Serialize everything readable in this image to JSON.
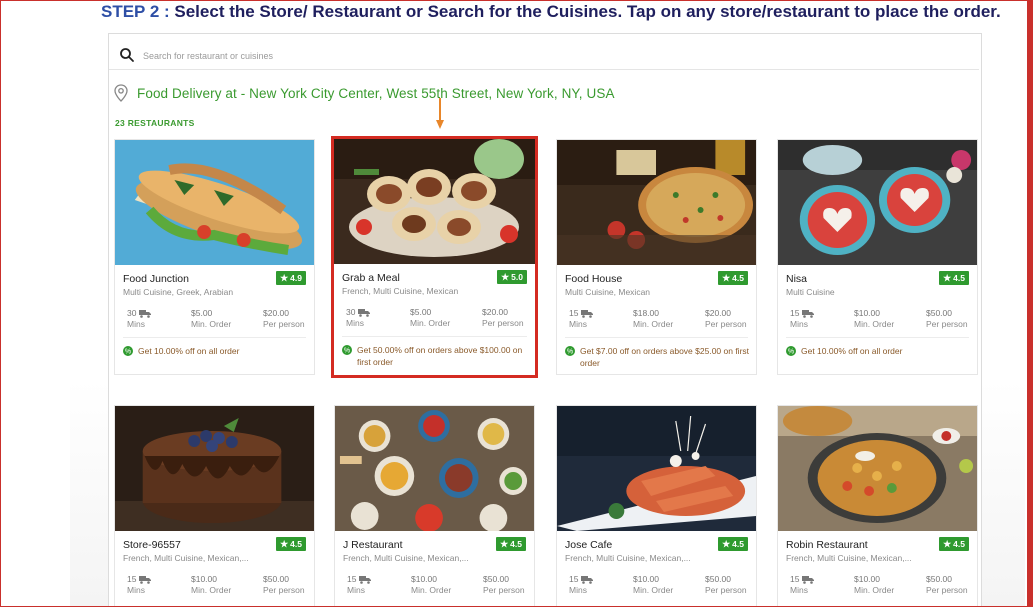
{
  "instruction": {
    "step_label": "STEP 2 :",
    "text": "Select the Store/ Restaurant or Search for the Cuisines. Tap on any store/restaurant to place the order."
  },
  "search": {
    "placeholder": "Search for restaurant or cuisines"
  },
  "location": {
    "text": "Food Delivery at - New York City Center, West 55th Street, New York, NY, USA"
  },
  "restaurant_count": "23 RESTAURANTS",
  "colors": {
    "accent_green": "#3a9a2f",
    "rating_green": "#2f9a2f",
    "highlight_red": "#d42b22",
    "arrow_orange": "#e8862a"
  },
  "restaurants": [
    {
      "name": "Food Junction",
      "cuisine": "Multi Cuisine, Greek, Arabian",
      "rating": "4.9",
      "time": "30",
      "time_label": "Mins",
      "min_order": "$5.00",
      "min_order_label": "Min. Order",
      "per_person": "$20.00",
      "per_person_label": "Per person",
      "offer": "Get 10.00% off on all order",
      "photo": "sandwich-image"
    },
    {
      "name": "Grab a Meal",
      "cuisine": "French, Multi Cuisine, Mexican",
      "rating": "5.0",
      "time": "30",
      "time_label": "Mins",
      "min_order": "$5.00",
      "min_order_label": "Min. Order",
      "per_person": "$20.00",
      "per_person_label": "Per person",
      "offer": "Get 50.00% off on orders above $100.00 on first order",
      "photo": "wraps-image",
      "selected": true
    },
    {
      "name": "Food House",
      "cuisine": "Multi Cuisine, Mexican",
      "rating": "4.5",
      "time": "15",
      "time_label": "Mins",
      "min_order": "$18.00",
      "min_order_label": "Min. Order",
      "per_person": "$20.00",
      "per_person_label": "Per person",
      "offer": "Get $7.00 off on orders above $25.00 on first order",
      "photo": "pizza-image"
    },
    {
      "name": "Nisa",
      "cuisine": "Multi Cuisine",
      "rating": "4.5",
      "time": "15",
      "time_label": "Mins",
      "min_order": "$10.00",
      "min_order_label": "Min. Order",
      "per_person": "$50.00",
      "per_person_label": "Per person",
      "offer": "Get 10.00% off on all order",
      "photo": "heart-pancakes-image"
    },
    {
      "name": "Store-96557",
      "cuisine": "French, Multi Cuisine, Mexican,...",
      "rating": "4.5",
      "time": "15",
      "time_label": "Mins",
      "min_order": "$10.00",
      "min_order_label": "Min. Order",
      "per_person": "$50.00",
      "per_person_label": "Per person",
      "photo": "chocolate-cake-image"
    },
    {
      "name": "J Restaurant",
      "cuisine": "French, Multi Cuisine, Mexican,...",
      "rating": "4.5",
      "time": "15",
      "time_label": "Mins",
      "min_order": "$10.00",
      "min_order_label": "Min. Order",
      "per_person": "$50.00",
      "per_person_label": "Per person",
      "photo": "table-spread-image"
    },
    {
      "name": "Jose Cafe",
      "cuisine": "French, Multi Cuisine, Mexican,...",
      "rating": "4.5",
      "time": "15",
      "time_label": "Mins",
      "min_order": "$10.00",
      "min_order_label": "Min. Order",
      "per_person": "$50.00",
      "per_person_label": "Per person",
      "photo": "pasta-image"
    },
    {
      "name": "Robin Restaurant",
      "cuisine": "French, Multi Cuisine, Mexican,...",
      "rating": "4.5",
      "time": "15",
      "time_label": "Mins",
      "min_order": "$10.00",
      "min_order_label": "Min. Order",
      "per_person": "$50.00",
      "per_person_label": "Per person",
      "photo": "chickpea-curry-image"
    }
  ]
}
